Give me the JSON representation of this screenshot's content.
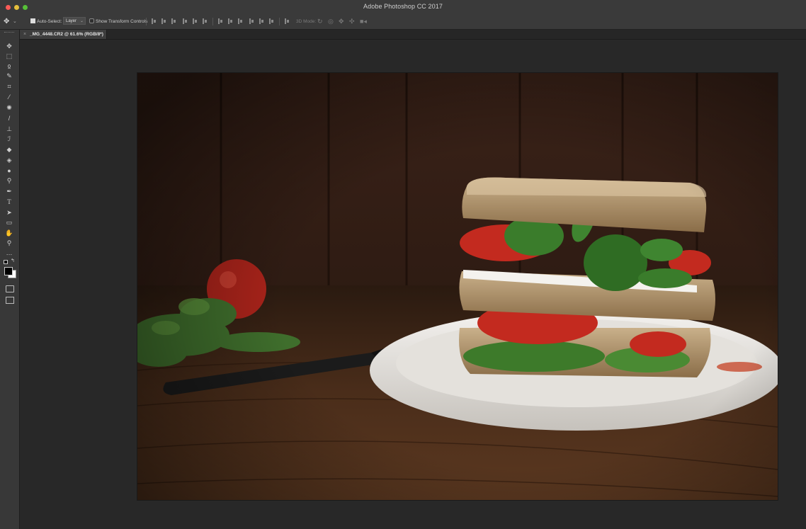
{
  "window": {
    "title": "Adobe Photoshop CC 2017",
    "traffic_lights": {
      "close": "#fc5b57",
      "minimize": "#e5bf3c",
      "zoom": "#57c038"
    }
  },
  "options_bar": {
    "tool_icon": "move-tool-icon",
    "auto_select_label": "Auto-Select:",
    "auto_select_checked": true,
    "auto_select_target": "Layer",
    "show_transform_label": "Show Transform Controls",
    "show_transform_checked": false,
    "mode_3d_label": "3D Mode:"
  },
  "document_tab": {
    "close_glyph": "×",
    "title": "_MG_4448.CR2 @ 61.6% (RGB/8*)"
  },
  "tools": [
    {
      "name": "move-tool-icon",
      "glyph": "✥"
    },
    {
      "name": "marquee-tool-icon",
      "glyph": "⬚"
    },
    {
      "name": "lasso-tool-icon",
      "glyph": "ჲ"
    },
    {
      "name": "magic-wand-tool-icon",
      "glyph": "✎"
    },
    {
      "name": "crop-tool-icon",
      "glyph": "⌗"
    },
    {
      "name": "eyedropper-tool-icon",
      "glyph": "⁄"
    },
    {
      "name": "healing-brush-tool-icon",
      "glyph": "✺"
    },
    {
      "name": "brush-tool-icon",
      "glyph": "/"
    },
    {
      "name": "clone-stamp-tool-icon",
      "glyph": "⊥"
    },
    {
      "name": "history-brush-tool-icon",
      "glyph": "ℐ"
    },
    {
      "name": "eraser-tool-icon",
      "glyph": "◆"
    },
    {
      "name": "paint-bucket-tool-icon",
      "glyph": "◈"
    },
    {
      "name": "blur-tool-icon",
      "glyph": "●"
    },
    {
      "name": "dodge-tool-icon",
      "glyph": "⚲"
    },
    {
      "name": "pen-tool-icon",
      "glyph": "✒"
    },
    {
      "name": "type-tool-icon",
      "glyph": "T"
    },
    {
      "name": "path-selection-tool-icon",
      "glyph": "➤"
    },
    {
      "name": "rectangle-tool-icon",
      "glyph": "▭"
    },
    {
      "name": "hand-tool-icon",
      "glyph": "✋"
    },
    {
      "name": "zoom-tool-icon",
      "glyph": "⚲"
    },
    {
      "name": "more-tools-icon",
      "glyph": "…"
    }
  ],
  "colors": {
    "foreground": "#000000",
    "background": "#ffffff",
    "canvas_bg": "#282828",
    "panel_bg": "#383838"
  }
}
